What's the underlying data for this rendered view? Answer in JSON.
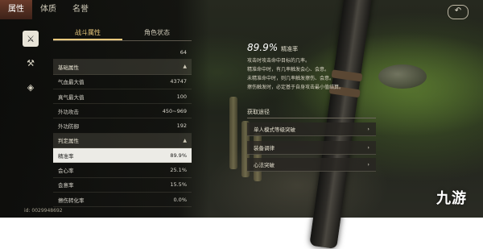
{
  "top_tabs": [
    "属性",
    "体质",
    "名誉"
  ],
  "back_icon": "back-arrow-icon",
  "side_icons": [
    "sword-stats-icon",
    "crossed-tools-icon",
    "money-bag-icon"
  ],
  "sub_tabs": [
    "战斗属性",
    "角色状态"
  ],
  "stats": {
    "first_row": {
      "label": "",
      "value": "64"
    },
    "groups": [
      {
        "title": "基础属性",
        "rows": [
          {
            "label": "气血最大值",
            "value": "43747"
          },
          {
            "label": "真气最大值",
            "value": "100"
          },
          {
            "label": "外功攻击",
            "value": "450~969"
          },
          {
            "label": "外功防御",
            "value": "192"
          }
        ]
      },
      {
        "title": "判定属性",
        "rows": [
          {
            "label": "精准率",
            "value": "89.9%"
          },
          {
            "label": "会心率",
            "value": "25.1%"
          },
          {
            "label": "会意率",
            "value": "15.5%"
          },
          {
            "label": "擦伤转化率",
            "value": "0.0%"
          }
        ]
      }
    ]
  },
  "player_id": "id: 0029948692",
  "detail": {
    "percent": "89.9%",
    "name": "精准率",
    "description": "攻击时攻击命中目标的几率。\n精准命中时，有几率触发会心、会意。\n未精准命中时，则几率触发擦伤、会意。\n擦伤触发时，必定基于自身攻击最小值结算。"
  },
  "sources": {
    "title": "获取途径",
    "items": [
      "单人模式等级突破",
      "装备调律",
      "心法突破"
    ]
  },
  "watermark": "九游"
}
